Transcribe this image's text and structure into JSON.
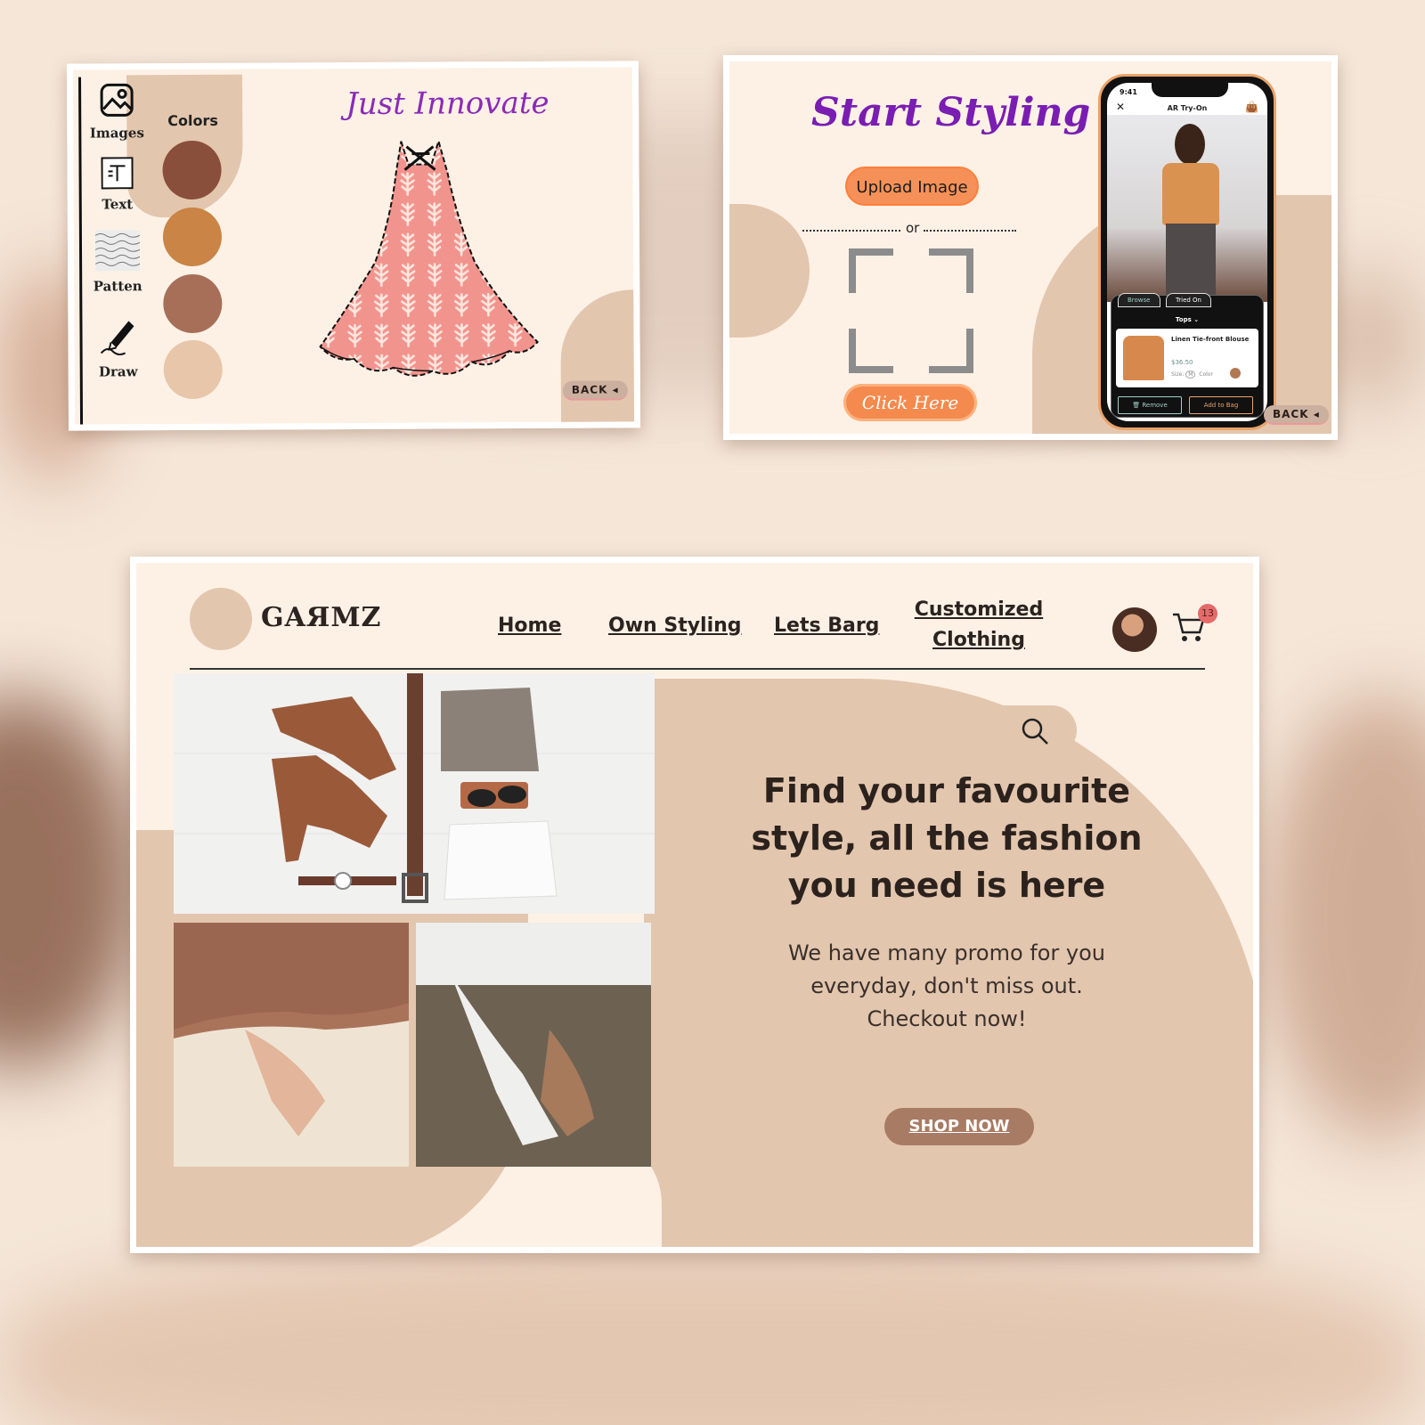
{
  "editor": {
    "tools": [
      {
        "label": "Images",
        "icon": "image-icon"
      },
      {
        "label": "Text",
        "icon": "text-icon"
      },
      {
        "label": "Patten",
        "icon": "pattern-icon"
      },
      {
        "label": "Draw",
        "icon": "pen-icon"
      }
    ],
    "colors_label": "Colors",
    "colors": [
      "#8a4f3a",
      "#c98446",
      "#a76f58",
      "#e7c6a9"
    ],
    "title": "Just Innovate",
    "back_label": "BACK"
  },
  "styling": {
    "title": "Start Styling",
    "upload_label": "Upload Image",
    "or_label": "or",
    "click_label": "Click Here",
    "back_label": "BACK",
    "phone": {
      "time": "9:41",
      "title": "AR Try-On",
      "tabs": [
        "Browse",
        "Tried On"
      ],
      "category": "Tops",
      "product_name": "Linen Tie-front Blouse",
      "price": "$36.50",
      "size_label": "Size:",
      "size_value": "M",
      "color_label": "Color",
      "remove_label": "Remove",
      "add_label": "Add to Bag"
    }
  },
  "shop": {
    "brand": "GAЯMZ",
    "nav": [
      "Home",
      "Own Styling",
      "Lets Barg",
      "Customized Clothing"
    ],
    "cart_count": "13",
    "headline": "Find your favourite style, all the fashion you need is here",
    "subtext": "We have many promo for you everyday, don't miss out. Checkout now!",
    "cta": "SHOP NOW"
  },
  "colors": {
    "background": "#fdf1e6",
    "accent_tan": "#e3c6ae",
    "accent_orange": "#f59158",
    "accent_purple": "#7a1db2",
    "button_brown": "#a87b65"
  }
}
